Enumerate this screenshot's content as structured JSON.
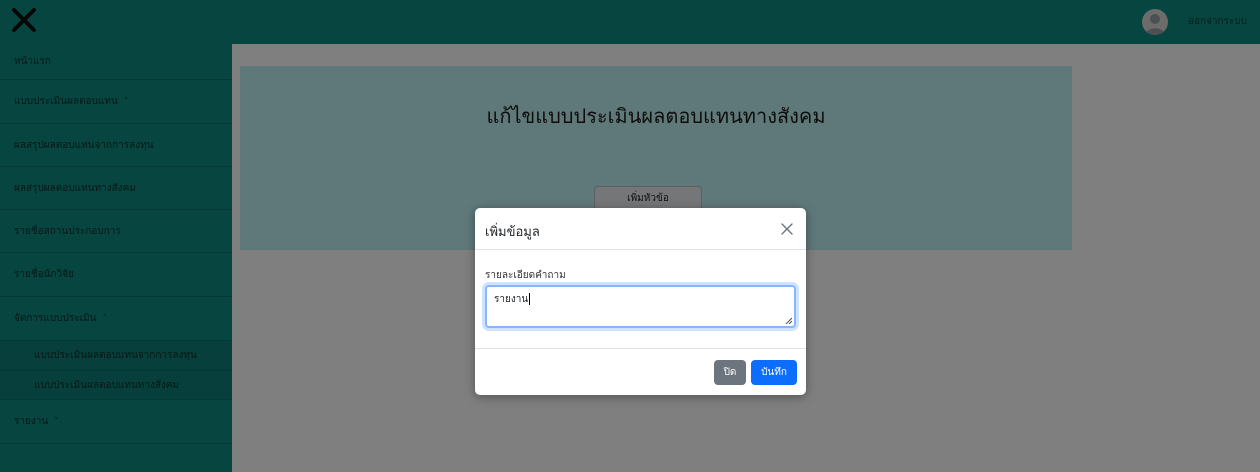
{
  "topbar": {
    "logo_icon": "x-close-icon",
    "avatar_icon": "user-avatar-icon",
    "logout_label": "ออกจากระบบ"
  },
  "sidebar": {
    "items": [
      {
        "label": "หน้าแรก"
      },
      {
        "label": "แบบประเมินผลตอบแทน",
        "chevron": "˅"
      },
      {
        "label": "ผลสรุปผลตอบแทนจากการลงทุน"
      },
      {
        "label": "ผลสรุปผลตอบแทนทางสังคม"
      },
      {
        "label": "รายชื่อสถานประกอบการ"
      },
      {
        "label": "รายชื่อนักวิจัย"
      },
      {
        "label": "จัดการแบบประเมิน",
        "chevron": "˄"
      },
      {
        "label": "แบบประเมินผลตอบแทนจากการลงทุน"
      },
      {
        "label": "แบบประเมินผลตอบแทนทางสังคม"
      },
      {
        "label": "รายงาน",
        "chevron": "˅"
      }
    ]
  },
  "main": {
    "title": "แก้ไขแบบประเมินผลตอบแทนทางสังคม",
    "add_topic_label": "เพิ่มหัวข้อ"
  },
  "modal": {
    "title": "เพิ่มข้อมูล",
    "close_icon": "close-icon",
    "field_label": "รายละเอียดคำถาม",
    "field_value": "รายงาน",
    "close_button": "ปิด",
    "save_button": "บันทึก"
  },
  "colors": {
    "teal": "#0f8a82",
    "panel": "#bff0f3",
    "primary": "#0d6efd",
    "secondary": "#6c757d"
  }
}
